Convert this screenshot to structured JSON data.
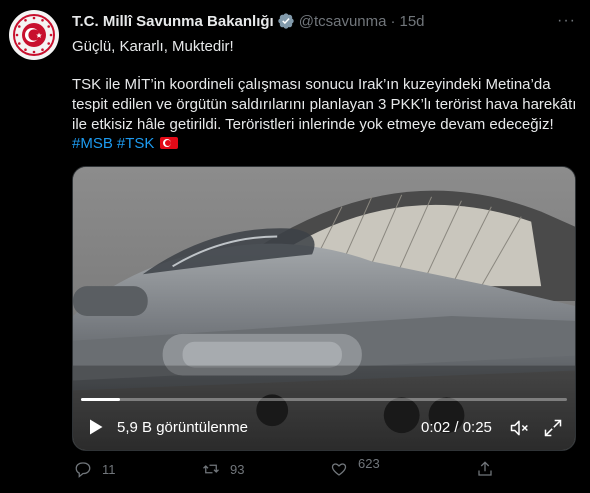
{
  "tweet": {
    "author_name": "T.C. Millî Savunma Bakanlığı",
    "handle": "@tcsavunma",
    "separator": "·",
    "time": "15d",
    "more": "···",
    "tagline": "Güçlü, Kararlı, Muktedir!",
    "body": "TSK ile MİT’in koordineli çalışması sonucu Irak’ın kuzeyindeki Metina’da tespit edilen ve örgütün saldırılarını planlayan 3 PKK’lı terörist hava harekâtı ile etkisiz hâle getirildi. Teröristleri inlerinde yok etmeye devam edeceğiz!",
    "hashtags": [
      "#MSB",
      "#TSK"
    ],
    "flag_icon": "turkey-flag-icon"
  },
  "video": {
    "views_label": "5,9 B görüntülenme",
    "time_label": "0:02 / 0:25",
    "progress": 0.08
  },
  "actions": {
    "reply_count": "11",
    "retweet_count": "93",
    "like_count": "623",
    "like_secondary": "",
    "share_label": ""
  },
  "colors": {
    "background": "#000000",
    "text": "#e7e9ea",
    "muted": "#71767b",
    "link": "#1d9bf0",
    "verified": "#829aab",
    "emblem_red": "#c8102e"
  }
}
